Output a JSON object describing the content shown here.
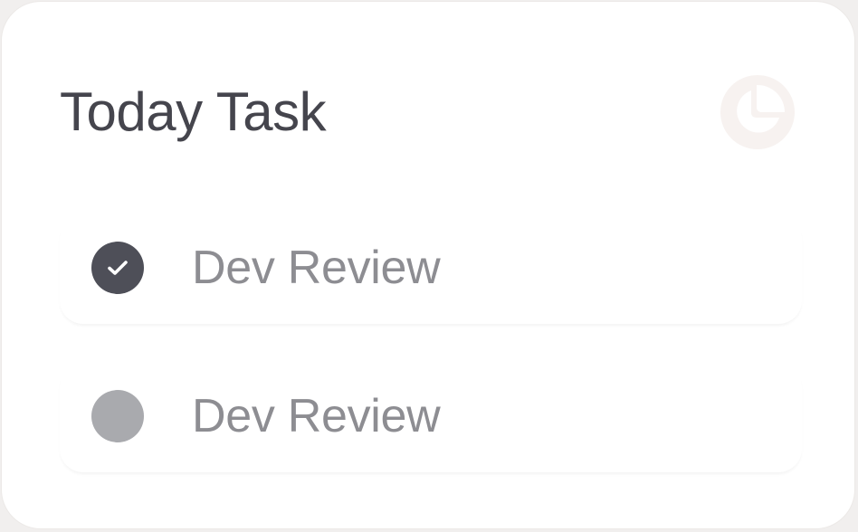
{
  "card": {
    "title": "Today Task",
    "menu_icon": "pie-chart-icon"
  },
  "tasks": [
    {
      "label": "Dev Review",
      "checked": true,
      "icon": "check-icon"
    },
    {
      "label": "Dev Review",
      "checked": false
    }
  ],
  "colors": {
    "title": "#45454d",
    "task_text": "#8d8d92",
    "checked_fill": "#4e4f58",
    "unchecked_fill": "#a9aaae",
    "menu_button_bg": "#f7f2f0",
    "card_bg": "#ffffff"
  }
}
